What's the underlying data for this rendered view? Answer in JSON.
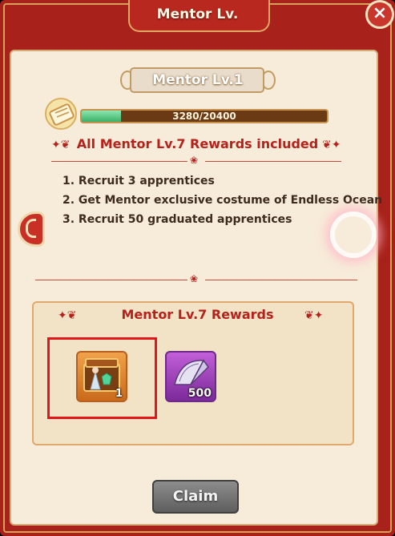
{
  "window": {
    "title": "Mentor Lv.",
    "close_label": "×"
  },
  "level": {
    "label": "Mentor Lv.1",
    "exp_text": "3280/20400",
    "exp_current": 3280,
    "exp_max": 20400
  },
  "requirements": {
    "heading": "All Mentor Lv.7 Rewards included",
    "items": [
      "1. Recruit 3 apprentices",
      "2. Get Mentor exclusive costume of Endless Ocean",
      "3. Recruit 50 graduated apprentices"
    ]
  },
  "rewards": {
    "title": "Mentor Lv.7 Rewards",
    "items": [
      {
        "icon": "costume-chest-icon",
        "count": "1"
      },
      {
        "icon": "fan-icon",
        "count": "500"
      }
    ]
  },
  "actions": {
    "claim_label": "Claim"
  },
  "colors": {
    "frame_red": "#a8211a",
    "panel_cream": "#f7ecd9",
    "heading_red": "#b5221c",
    "highlight_red": "#e3141b"
  }
}
